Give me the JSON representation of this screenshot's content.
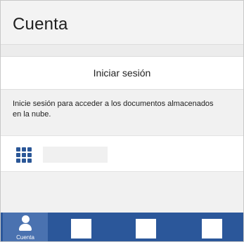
{
  "header": {
    "title": "Cuenta"
  },
  "signin": {
    "label": "Iniciar sesión"
  },
  "description": {
    "text": "Inicie sesión para acceder a los documentos almacenados en la nube."
  },
  "apps_row": {
    "icon": "grid-icon"
  },
  "tabbar": {
    "accent": "#2b579a",
    "active_tab": {
      "label": "Cuenta",
      "icon": "person-icon"
    },
    "other_tabs": [
      {
        "icon": "square-placeholder-icon"
      },
      {
        "icon": "square-placeholder-icon"
      },
      {
        "icon": "square-placeholder-icon"
      }
    ]
  }
}
